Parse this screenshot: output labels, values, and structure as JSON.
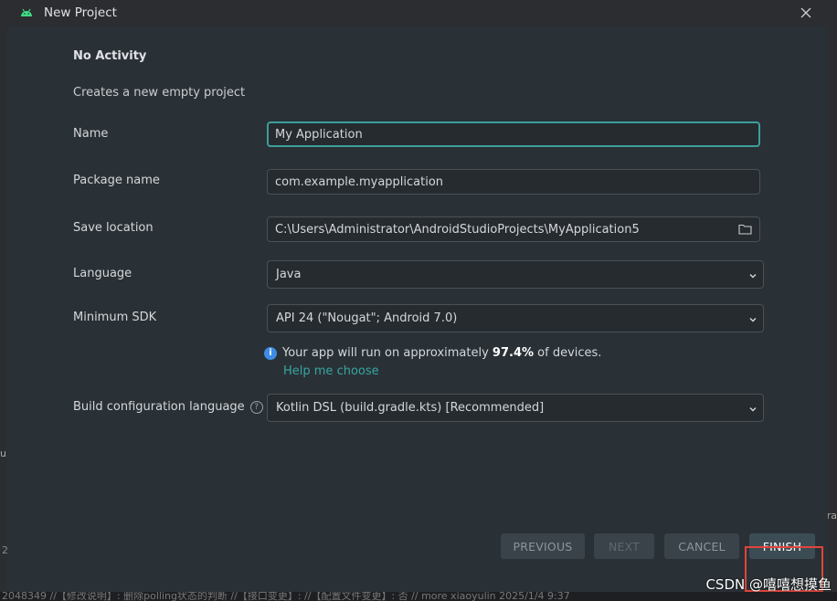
{
  "window": {
    "title": "New Project"
  },
  "form": {
    "section_title": "No Activity",
    "section_description": "Creates a new empty project",
    "name": {
      "label": "Name",
      "value": "My Application"
    },
    "package": {
      "label": "Package name",
      "value": "com.example.myapplication"
    },
    "location": {
      "label": "Save location",
      "value": "C:\\Users\\Administrator\\AndroidStudioProjects\\MyApplication5"
    },
    "language": {
      "label": "Language",
      "value": "Java"
    },
    "min_sdk": {
      "label": "Minimum SDK",
      "value": "API 24 (\"Nougat\"; Android 7.0)"
    },
    "info": {
      "prefix": "Your app will run on approximately ",
      "percent": "97.4%",
      "suffix": " of devices.",
      "help_link": "Help me choose"
    },
    "build_config": {
      "label": "Build configuration language",
      "value": "Kotlin DSL (build.gradle.kts) [Recommended]"
    }
  },
  "buttons": {
    "previous": "PREVIOUS",
    "next": "NEXT",
    "cancel": "CANCEL",
    "finish": "FINISH"
  },
  "background": {
    "left_text": "u",
    "left_tiny": "2",
    "right_text": "ra",
    "bottom_text": "2048349 //【修改说明】: 删除polling状态的判断 //【接口变更】: //【配置文件变更】: 否 // more     xiaoyulin  2025/1/4 9:37"
  },
  "watermark": "CSDN @嘻嘻想摸鱼",
  "colors": {
    "accent": "#3d9e9c",
    "link": "#36a6a2",
    "info": "#3e8ce6",
    "highlight": "#e0453a"
  }
}
